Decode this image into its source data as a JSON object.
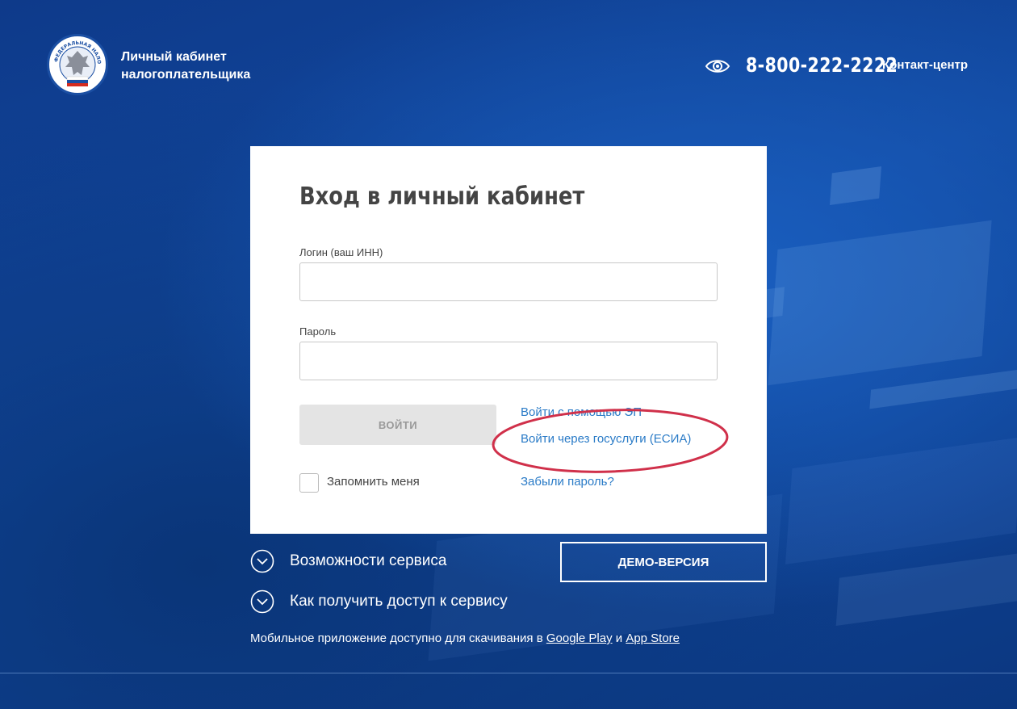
{
  "header": {
    "logo_text": "ФЕДЕРАЛЬНАЯ НАЛОГОВАЯ СЛУЖБА",
    "title_line1": "Личный кабинет",
    "title_line2": "налогоплательщика",
    "phone": "8-800-222-2222",
    "contact_label": "Контакт-центр",
    "accessibility_icon": "eye-icon"
  },
  "login_card": {
    "title": "Вход в личный кабинет",
    "login_label": "Логин (ваш ИНН)",
    "login_value": "",
    "password_label": "Пароль",
    "password_value": "",
    "submit_label": "ВОЙТИ",
    "link_ep": "Войти с помощью ЭП",
    "link_esia": "Войти через госуслуги (ЕСИА)",
    "remember_label": "Запомнить меня",
    "remember_checked": false,
    "forgot_label": "Забыли пароль?",
    "highlight_color": "#d0304a"
  },
  "below": {
    "features_label": "Возможности сервиса",
    "access_label": "Как получить доступ к сервису",
    "demo_label": "ДЕМО-ВЕРСИЯ",
    "mobile_text": "Мобильное приложение доступно для скачивания в",
    "google_play": "Google Play",
    "and": "и",
    "app_store": "App Store"
  },
  "colors": {
    "background": "#124aa2",
    "link": "#2a7bc7",
    "button_disabled": "#e4e4e4"
  }
}
